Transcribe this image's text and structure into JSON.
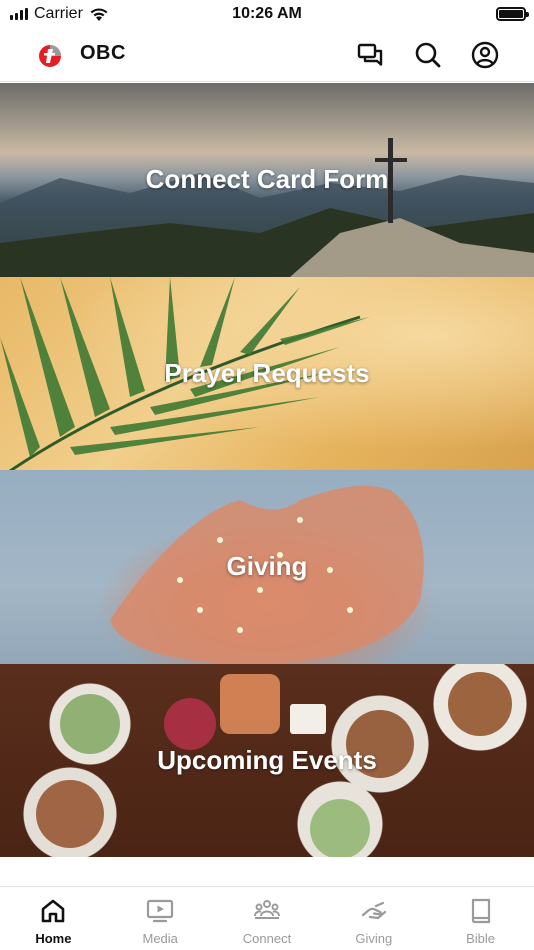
{
  "status_bar": {
    "carrier": "Carrier",
    "time": "10:26 AM",
    "battery_level": 1.0
  },
  "header": {
    "title": "OBC",
    "icons": [
      "chat-icon",
      "search-icon",
      "profile-icon"
    ],
    "logo_colors": {
      "red": "#e31e24",
      "gray": "#9b9b9b"
    }
  },
  "tiles": [
    {
      "label": "Connect Card Form"
    },
    {
      "label": "Prayer Requests"
    },
    {
      "label": "Giving"
    },
    {
      "label": "Upcoming Events"
    }
  ],
  "tab_bar": {
    "active": "Home",
    "tabs": [
      {
        "label": "Home",
        "icon": "home-icon"
      },
      {
        "label": "Media",
        "icon": "media-icon"
      },
      {
        "label": "Connect",
        "icon": "connect-icon"
      },
      {
        "label": "Giving",
        "icon": "giving-icon"
      },
      {
        "label": "Bible",
        "icon": "bible-icon"
      }
    ],
    "colors": {
      "active": "#111111",
      "inactive": "#9a9a9a"
    }
  }
}
